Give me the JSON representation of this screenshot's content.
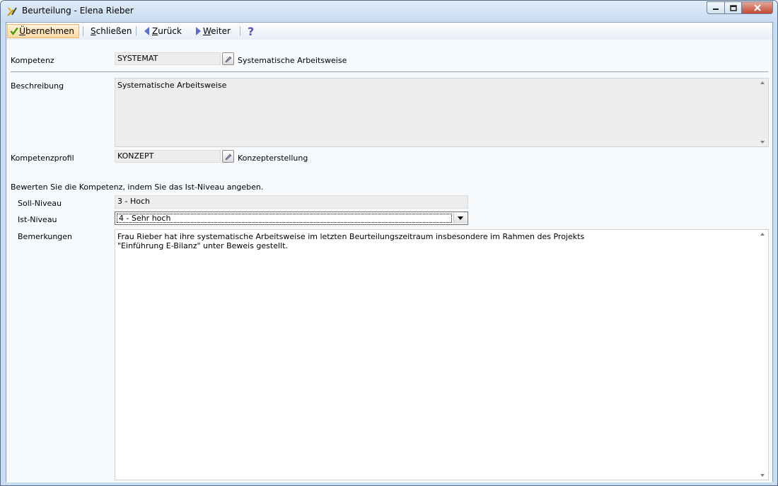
{
  "window": {
    "title": "Beurteilung - Elena Rieber"
  },
  "toolbar": {
    "accept": {
      "prefix": "Ü",
      "rest": "bernehmen"
    },
    "close": {
      "prefix": "S",
      "rest": "chließen"
    },
    "back": {
      "prefix": "Z",
      "rest": "urück"
    },
    "next": {
      "prefix": "W",
      "rest": "eiter"
    },
    "help_icon": "question-mark"
  },
  "form": {
    "kompetenz": {
      "label": "Kompetenz",
      "code": "SYSTEMAT",
      "name": "Systematische Arbeitsweise"
    },
    "beschreibung": {
      "label": "Beschreibung",
      "text": "Systematische Arbeitsweise"
    },
    "kompetenzprofil": {
      "label": "Kompetenzprofil",
      "code": "KONZEPT",
      "name": "Konzepterstellung"
    },
    "instruction": "Bewerten Sie die Kompetenz, indem Sie das Ist-Niveau angeben.",
    "soll": {
      "label": "Soll-Niveau",
      "value": "3 - Hoch"
    },
    "ist": {
      "label": "Ist-Niveau",
      "value": "4 - Sehr hoch"
    },
    "bemerkungen": {
      "label": "Bemerkungen",
      "text": "Frau Rieber hat ihre systematische Arbeitsweise im letzten Beurteilungszeitraum insbesondere im Rahmen des Projekts\n\"Einführung E-Bilanz\" unter Beweis gestellt."
    }
  },
  "colors": {
    "accent_check": "#3aa000",
    "nav_arrow": "#5b6fc8",
    "help": "#5b4fc8",
    "close_button": "#c24a33"
  }
}
